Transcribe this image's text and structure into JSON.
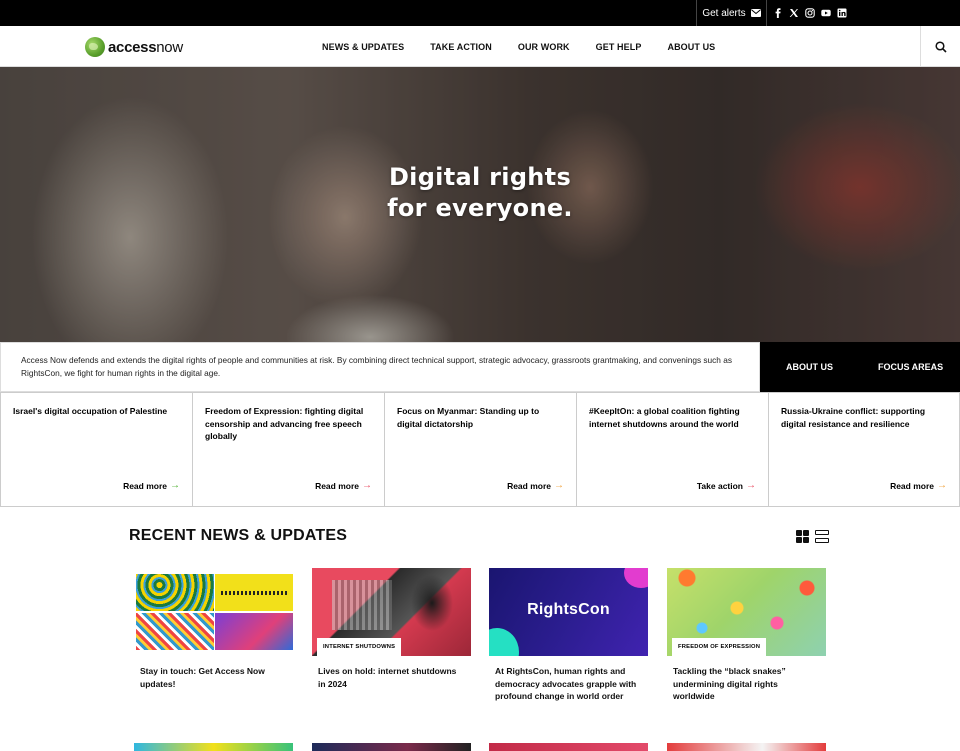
{
  "topbar": {
    "alerts_label": "Get alerts",
    "social": [
      "facebook-icon",
      "x-icon",
      "instagram-icon",
      "youtube-icon",
      "linkedin-icon"
    ]
  },
  "header": {
    "logo_text_a": "access",
    "logo_text_b": "now",
    "nav": [
      "NEWS & UPDATES",
      "TAKE ACTION",
      "OUR WORK",
      "GET HELP",
      "ABOUT US"
    ]
  },
  "hero": {
    "headline_1": "Digital rights",
    "headline_2": "for everyone."
  },
  "mission": {
    "text": "Access Now defends and extends the digital rights of people and communities at risk. By combining direct technical support, strategic advocacy, grassroots grantmaking, and convenings such as RightsCon, we fight for human rights in the digital age.",
    "about_label": "ABOUT US",
    "focus_label": "FOCUS AREAS"
  },
  "cards": [
    {
      "title": "Israel's digital occupation of Palestine",
      "link": "Read more",
      "arrow_color": "#4caf2f"
    },
    {
      "title": "Freedom of Expression: fighting digital censorship and advancing free speech globally",
      "link": "Read more",
      "arrow_color": "#e84a5f"
    },
    {
      "title": "Focus on Myanmar: Standing up to digital dictatorship",
      "link": "Read more",
      "arrow_color": "#f0a13a"
    },
    {
      "title": "#KeepItOn: a global coalition fighting internet shutdowns around the world",
      "link": "Take action",
      "arrow_color": "#e84a5f"
    },
    {
      "title": "Russia-Ukraine conflict: supporting digital resistance and resilience",
      "link": "Read more",
      "arrow_color": "#f0a13a"
    }
  ],
  "news": {
    "title": "RECENT NEWS & UPDATES",
    "items": [
      {
        "title": "Stay in touch: Get Access Now updates!",
        "tag": ""
      },
      {
        "title": "Lives on hold: internet shutdowns in 2024",
        "tag": "INTERNET SHUTDOWNS"
      },
      {
        "title": "At RightsCon, human rights and democracy advocates grapple with profound change in world order",
        "tag": "",
        "image_text": "RightsCon"
      },
      {
        "title": "Tackling the “black snakes” undermining digital rights worldwide",
        "tag": "FREEDOM OF EXPRESSION"
      }
    ]
  },
  "colors": {
    "topbar": "#000000",
    "accent_green": "#4caf2f"
  }
}
